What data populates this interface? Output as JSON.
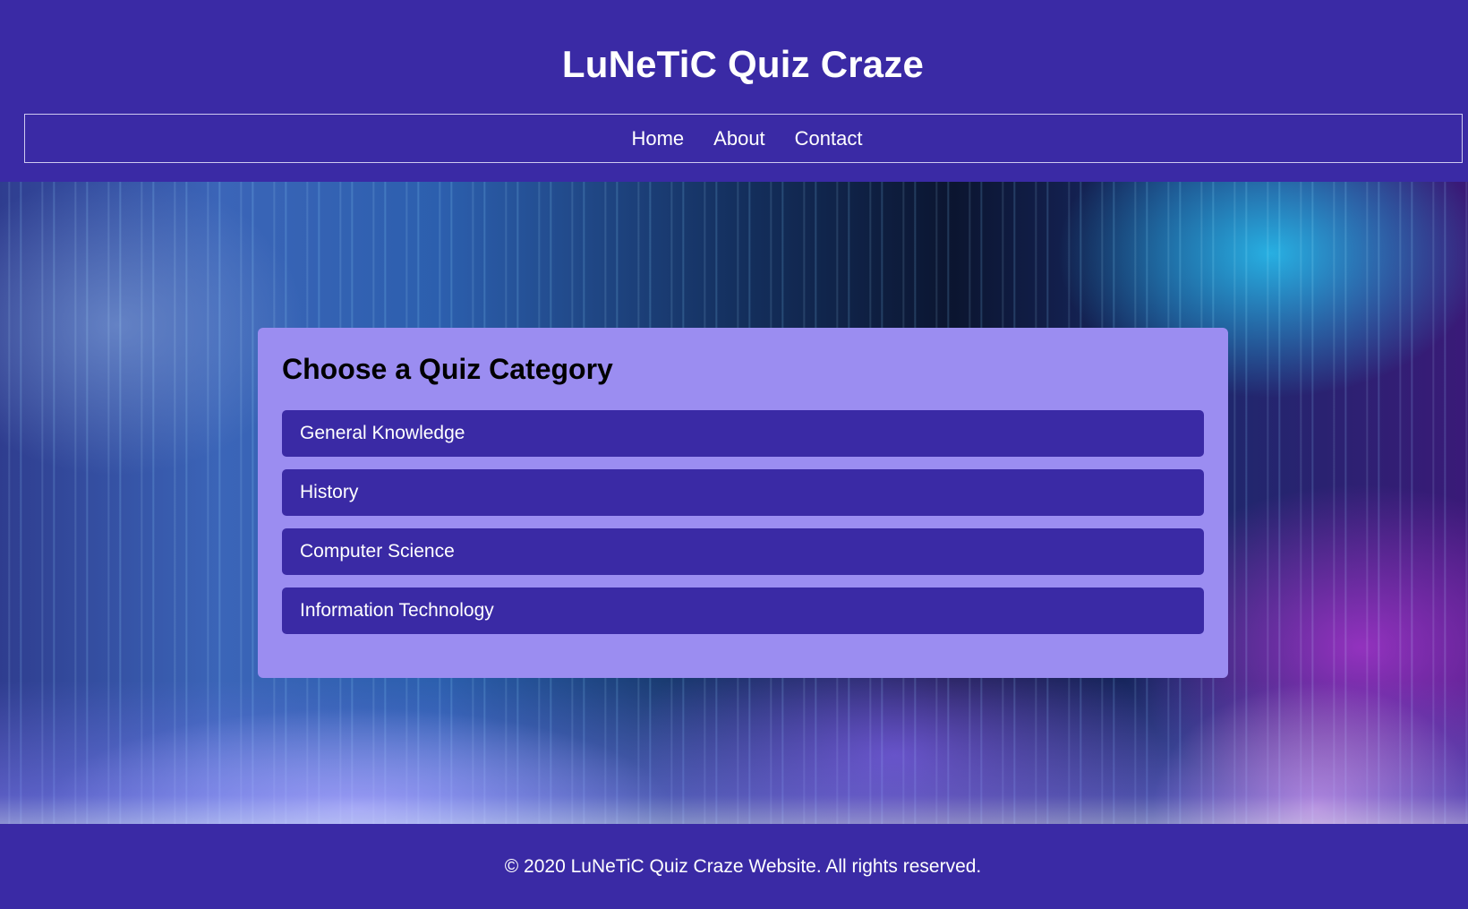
{
  "header": {
    "title": "LuNeTiC Quiz Craze",
    "nav": [
      {
        "label": "Home"
      },
      {
        "label": "About"
      },
      {
        "label": "Contact"
      }
    ]
  },
  "main": {
    "card_title": "Choose a Quiz Category",
    "categories": [
      {
        "label": "General Knowledge"
      },
      {
        "label": "History"
      },
      {
        "label": "Computer Science"
      },
      {
        "label": "Information Technology"
      }
    ]
  },
  "footer": {
    "text": "© 2020 LuNeTiC Quiz Craze Website. All rights reserved."
  },
  "colors": {
    "brand": "#3a2aa5",
    "card": "#9b8df1",
    "text": "#ffffff"
  }
}
